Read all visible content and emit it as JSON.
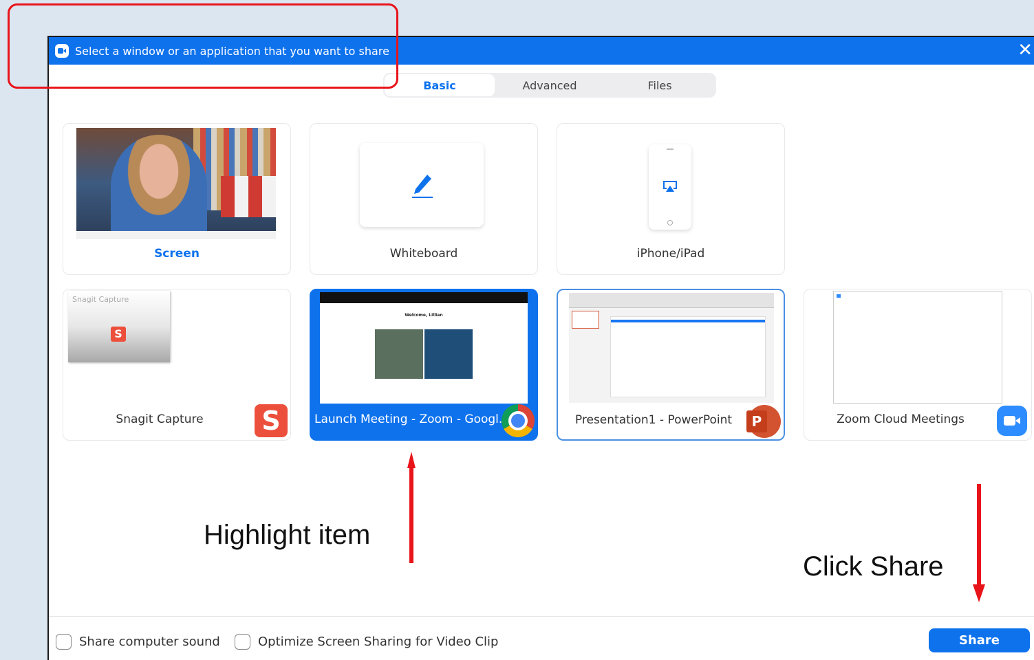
{
  "window": {
    "title": "Select a window or an application that you want to share"
  },
  "tabs": [
    {
      "label": "Basic",
      "active": true
    },
    {
      "label": "Advanced",
      "active": false
    },
    {
      "label": "Files",
      "active": false
    }
  ],
  "cards": {
    "screen": "Screen",
    "whiteboard": "Whiteboard",
    "iphone": "iPhone/iPad",
    "snagit": {
      "label": "Snagit Capture",
      "thumb_title": "Snagit Capture"
    },
    "chrome": "Launch Meeting - Zoom - Googl...",
    "chrome_thumb_heading": "Welcome, Lillian",
    "powerpoint": "Presentation1 - PowerPoint",
    "zoom_cloud": "Zoom Cloud Meetings"
  },
  "footer": {
    "share_sound": "Share computer sound",
    "optimize": "Optimize Screen Sharing for Video Clip",
    "share_button": "Share"
  },
  "annotations": {
    "highlight": "Highlight item",
    "click_share": "Click Share"
  },
  "colors": {
    "accent": "#0e72ed",
    "annotation_red": "#e8141a"
  }
}
